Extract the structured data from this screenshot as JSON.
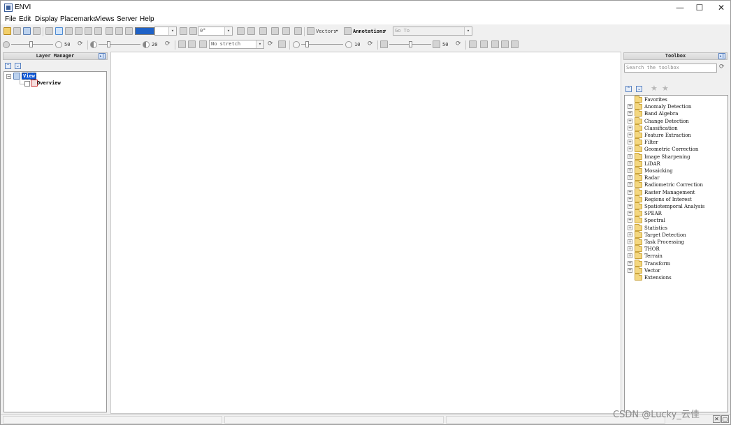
{
  "window": {
    "title": "ENVI",
    "controls": {
      "minimize": "—",
      "maximize": "☐",
      "close": "✕"
    }
  },
  "menu": [
    "File",
    "Edit",
    "Display",
    "Placemarks",
    "Views",
    "Server",
    "Help"
  ],
  "toolbar1": {
    "rotation_value": "0°",
    "vectors_label": "Vectors",
    "annotations_label": "Annotations",
    "goto_placeholder": "Go To"
  },
  "toolbar2": {
    "brightness_value": "50",
    "contrast_value": "20",
    "stretch_value": "No stretch",
    "sharpen_value": "10",
    "transparency_value": "50"
  },
  "layer_manager": {
    "title": "Layer Manager",
    "root_label": "View",
    "child_label": "Overview"
  },
  "toolbox": {
    "title": "Toolbox",
    "search_placeholder": "Search the toolbox",
    "items": [
      "Favorites",
      "Anomaly Detection",
      "Band Algebra",
      "Change Detection",
      "Classification",
      "Feature Extraction",
      "Filter",
      "Geometric Correction",
      "Image Sharpening",
      "LiDAR",
      "Mosaicking",
      "Radar",
      "Radiometric Correction",
      "Raster Management",
      "Regions of Interest",
      "Spatiotemporal Analysis",
      "SPEAR",
      "Spectral",
      "Statistics",
      "Target Detection",
      "Task Processing",
      "THOR",
      "Terrain",
      "Transform",
      "Vector",
      "Extensions"
    ]
  },
  "watermark": "CSDN @Lucky_云佳"
}
